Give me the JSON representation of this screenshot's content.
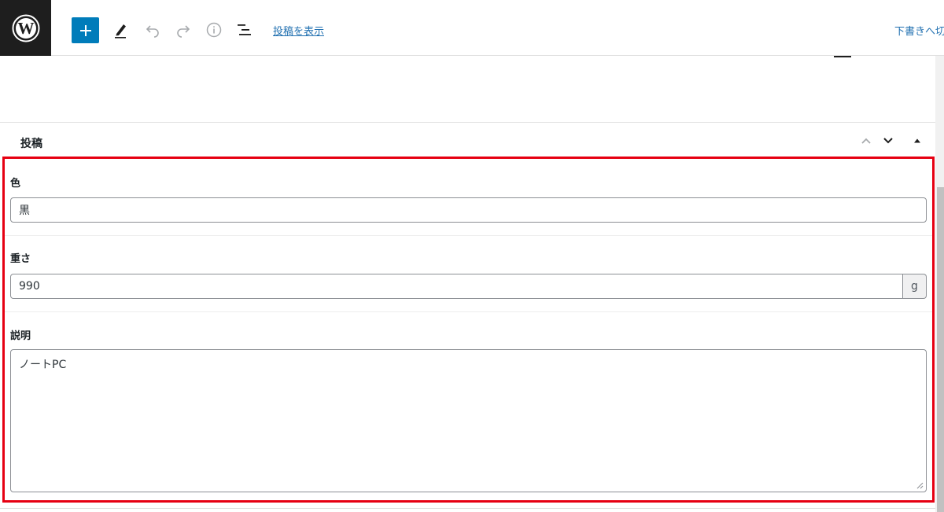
{
  "toolbar": {
    "view_post_label": "投稿を表示",
    "save_draft_label": "下書きへ切",
    "accent_color": "#007cba",
    "icons": {
      "logo": "wordpress-logo-icon",
      "add": "plus-icon",
      "tools": "pencil-icon",
      "undo": "undo-icon",
      "redo": "redo-icon",
      "details": "info-icon",
      "outline": "list-view-icon"
    }
  },
  "metabox": {
    "title": "投稿",
    "highlight_color": "#e60012",
    "fields": {
      "color": {
        "label": "色",
        "value": "黒"
      },
      "weight": {
        "label": "重さ",
        "value": "990",
        "unit": "g"
      },
      "description": {
        "label": "説明",
        "value": "ノートPC"
      }
    }
  }
}
